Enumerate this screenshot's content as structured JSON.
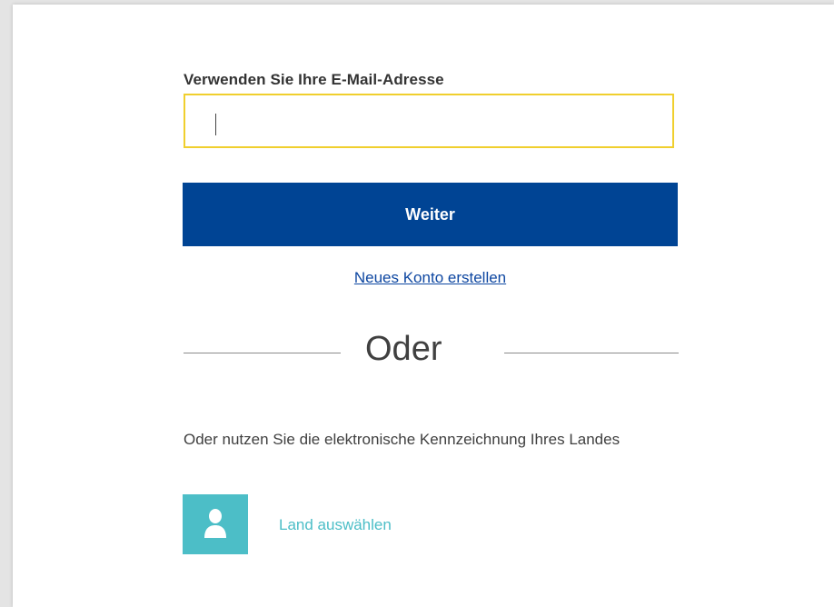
{
  "login": {
    "email_label": "Verwenden Sie Ihre E-Mail-Adresse",
    "email_value": "",
    "submit_label": "Weiter",
    "create_account_link": "Neues Konto erstellen",
    "divider_text": "Oder",
    "eid_text": "Oder nutzen Sie die elektronische Kennzeichnung Ihres Landes",
    "country_select_label": "Land auswählen"
  },
  "icons": {
    "country_icon": "person-icon"
  },
  "colors": {
    "primary_button": "#004494",
    "input_focus_border": "#f0cf2e",
    "accent_teal": "#4cbec7",
    "link_blue": "#0e47a1"
  }
}
